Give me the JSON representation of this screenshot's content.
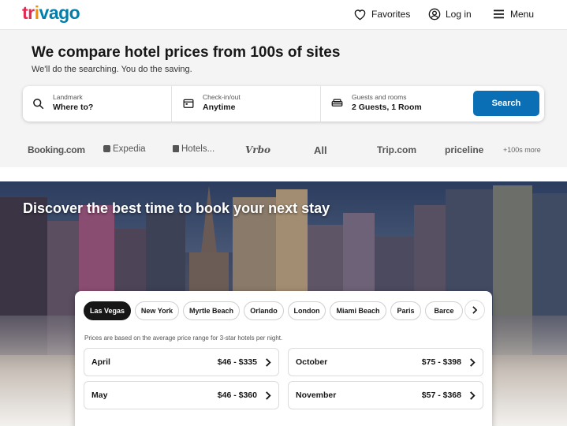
{
  "header": {
    "logo_letters": [
      {
        "ch": "t",
        "color": "#e32851"
      },
      {
        "ch": "r",
        "color": "#e32851"
      },
      {
        "ch": "i",
        "color": "#f48f00"
      },
      {
        "ch": "v",
        "color": "#007fad"
      },
      {
        "ch": "a",
        "color": "#007fad"
      },
      {
        "ch": "g",
        "color": "#007fad"
      },
      {
        "ch": "o",
        "color": "#007fad"
      }
    ],
    "favorites": "Favorites",
    "login": "Log in",
    "menu": "Menu"
  },
  "search": {
    "headline": "We compare hotel prices from 100s of sites",
    "subline": "We'll do the searching. You do the saving.",
    "destination_label": "Landmark",
    "destination_value": "Where to?",
    "dates_label": "Check-in/out",
    "dates_value": "Anytime",
    "guests_label": "Guests and rooms",
    "guests_value": "2 Guests, 1 Room",
    "button": "Search",
    "accent_color": "#0a6fb5"
  },
  "partners": {
    "booking": "Booking.com",
    "expedia": "Expedia",
    "hotels": "Hotels...",
    "vrbo": "Vrbo",
    "all": "All",
    "trip": "Trip.com",
    "priceline": "priceline",
    "more": "+100s more"
  },
  "hero": {
    "title": "Discover the best time to book your next stay"
  },
  "destinations": {
    "tabs": [
      "Las Vegas",
      "New York",
      "Myrtle Beach",
      "Orlando",
      "London",
      "Miami Beach",
      "Paris",
      "Barce"
    ],
    "active": "Las Vegas",
    "note": "Prices are based on the average price range for 3-star hotels per night.",
    "months": [
      {
        "month": "April",
        "price": "$46 - $335"
      },
      {
        "month": "October",
        "price": "$75 - $398"
      },
      {
        "month": "May",
        "price": "$46 - $360"
      },
      {
        "month": "November",
        "price": "$57 - $368"
      }
    ]
  }
}
